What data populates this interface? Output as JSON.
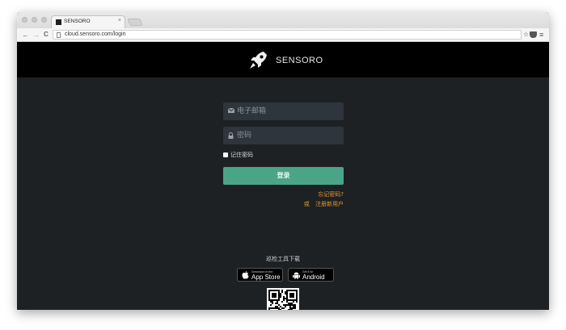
{
  "browser": {
    "tab_title": "SENSORO",
    "tab_close": "×",
    "back": "←",
    "forward": "→",
    "reload": "C",
    "url": "cloud.sensoro.com/login",
    "bookmark": "☆",
    "menu": "≡"
  },
  "header": {
    "brand": "SENSORO",
    "logo": "rocket-icon"
  },
  "login": {
    "email_placeholder": "电子邮箱",
    "email_icon": "envelope-icon",
    "password_placeholder": "密码",
    "password_icon": "lock-icon",
    "remember_label": "记住密码",
    "submit_label": "登录",
    "forgot_label": "忘记密码?",
    "or_label": "或",
    "register_label": "注册新用户"
  },
  "downloads": {
    "title": "巡检工具下载",
    "app_store_small": "Download on the",
    "app_store_big": "App Store",
    "android_small": "Get it for",
    "android_big": "Android"
  },
  "colors": {
    "header_bg": "#000000",
    "page_bg": "#1d2124",
    "input_bg": "#2e353c",
    "accent": "#4aa587",
    "link": "#e3962f"
  }
}
